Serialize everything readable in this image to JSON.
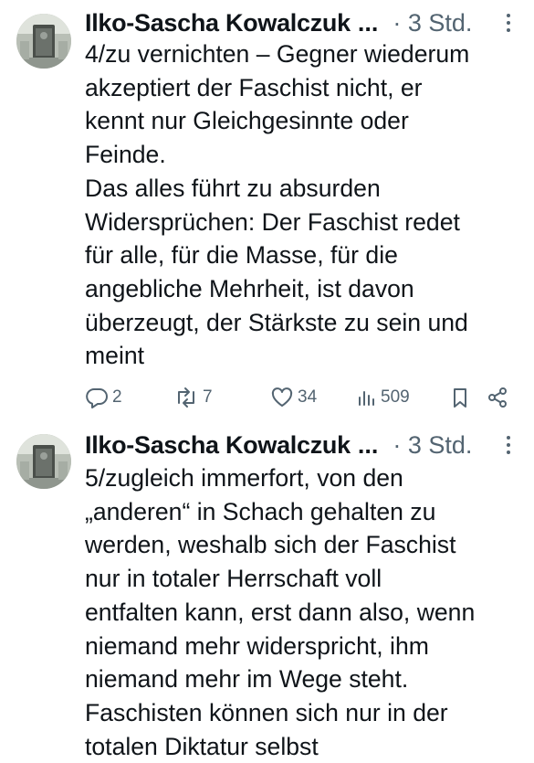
{
  "tweets": [
    {
      "author_name": "Ilko-Sascha Kowalczuk",
      "ellipsis": "...",
      "time": "· 3 Std.",
      "text_lines": [
        "4/zu vernichten – Gegner wiederum",
        "akzeptiert der Faschist nicht, er",
        "kennt nur Gleichgesinnte oder",
        "Feinde.",
        "Das alles führt zu absurden",
        "Widersprüchen: Der Faschist redet",
        "für alle, für die Masse, für die",
        "angebliche Mehrheit, ist davon",
        "überzeugt, der Stärkste zu sein und",
        "meint"
      ],
      "replies": "2",
      "reposts": "7",
      "likes": "34",
      "views": "509"
    },
    {
      "author_name": "Ilko-Sascha Kowalczuk",
      "ellipsis": "...",
      "time": "· 3 Std.",
      "text_lines": [
        "5/zugleich immerfort, von den",
        "„anderen“ in Schach gehalten zu",
        "werden, weshalb sich der Faschist",
        "nur in totaler Herrschaft voll",
        "entfalten kann, erst dann also, wenn",
        "niemand mehr widerspricht, ihm",
        "niemand mehr im Wege steht.",
        "Faschisten können sich nur in der",
        "totalen Diktatur selbst"
      ]
    }
  ],
  "colors": {
    "text": "#0f1419",
    "secondary": "#536471",
    "background": "#ffffff"
  },
  "icons": [
    "avatar-photo",
    "more-icon",
    "reply-icon",
    "repost-icon",
    "like-icon",
    "views-icon",
    "bookmark-icon",
    "share-icon"
  ]
}
